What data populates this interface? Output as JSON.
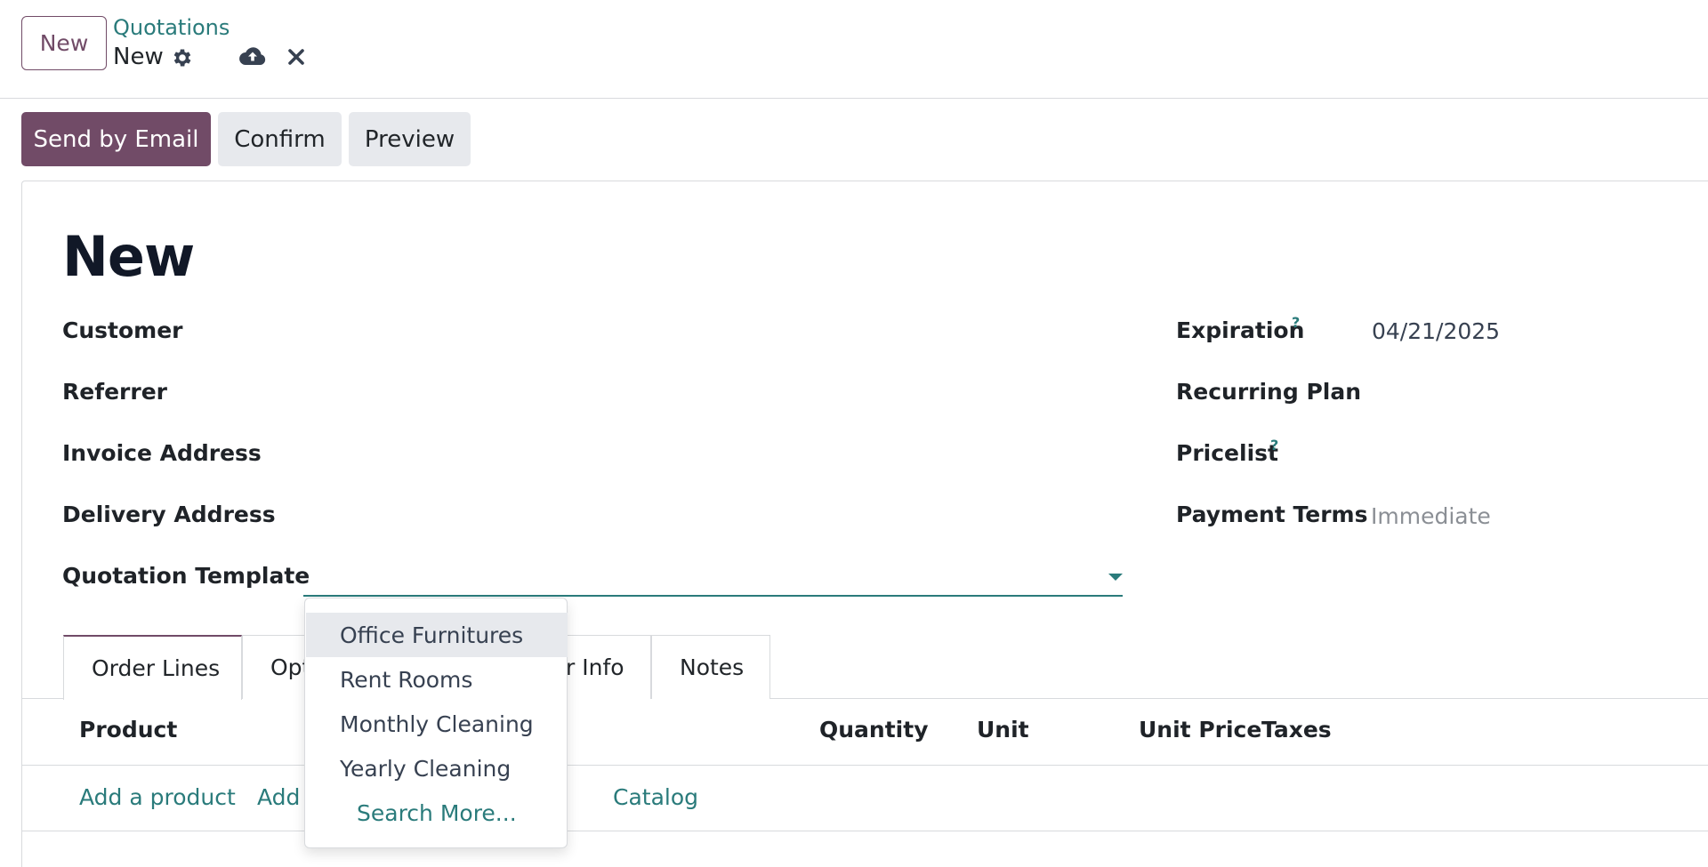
{
  "control_panel": {
    "new_button": "New",
    "breadcrumb_parent": "Quotations",
    "breadcrumb_current": "New"
  },
  "actions": {
    "send_by_email": "Send by Email",
    "confirm": "Confirm",
    "preview": "Preview"
  },
  "form": {
    "title": "New",
    "left_fields": {
      "customer": "Customer",
      "referrer": "Referrer",
      "invoice_address": "Invoice Address",
      "delivery_address": "Delivery Address",
      "quotation_template": "Quotation Template"
    },
    "right_fields": {
      "expiration_label": "Expiration",
      "expiration_value": "04/21/2025",
      "recurring_plan_label": "Recurring Plan",
      "pricelist_label": "Pricelist",
      "payment_terms_label": "Payment Terms",
      "payment_terms_placeholder": "Immediate",
      "help_mark": "?"
    }
  },
  "tabs": [
    "Order Lines",
    "Opt",
    "r Info",
    "Notes"
  ],
  "order_lines": {
    "columns": {
      "product": "Product",
      "quantity": "Quantity",
      "unit": "Unit",
      "unit_price": "Unit Price",
      "taxes": "Taxes"
    },
    "links": {
      "add_product": "Add a product",
      "add_partial": "Add",
      "catalog": "Catalog"
    }
  },
  "template_dropdown": {
    "options": [
      "Office Furnitures",
      "Rent Rooms",
      "Monthly Cleaning",
      "Yearly Cleaning"
    ],
    "search_more": "Search More..."
  },
  "colors": {
    "primary": "#714b67",
    "link": "#2a7b7b",
    "secondary_bg": "#e7e9ed",
    "border": "#d8dadd"
  }
}
